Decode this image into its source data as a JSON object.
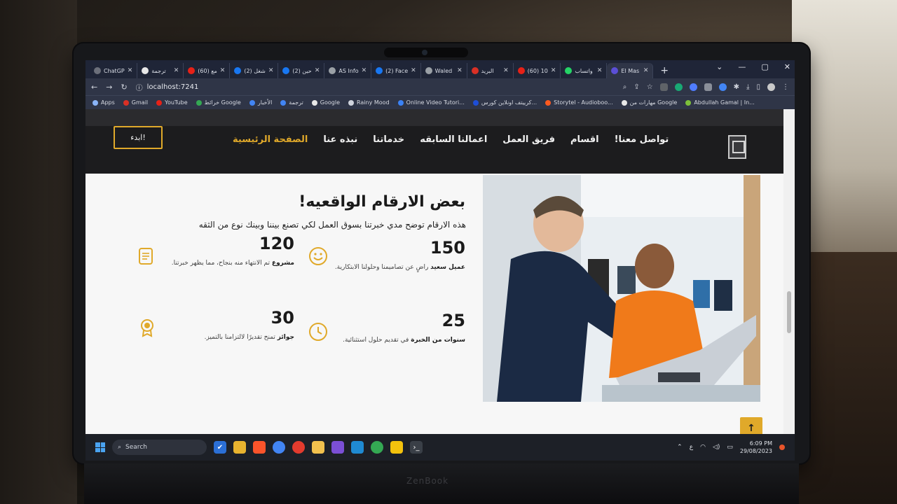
{
  "browser": {
    "tabs": [
      {
        "label": "ChatGP",
        "icon": "chatgpt-icon",
        "color": "#6b6f7a"
      },
      {
        "label": "ترجمة",
        "icon": "google-icon",
        "color": "#e8e8e8"
      },
      {
        "label": "(60) مع",
        "icon": "youtube-icon",
        "color": "#e62117"
      },
      {
        "label": "(2) شغل",
        "icon": "facebook-icon",
        "color": "#1877f2"
      },
      {
        "label": "(2) حين",
        "icon": "facebook-icon",
        "color": "#1877f2"
      },
      {
        "label": "AS Info",
        "icon": "globe-icon",
        "color": "#9aa0a6"
      },
      {
        "label": "(2) Face",
        "icon": "facebook-icon",
        "color": "#1877f2"
      },
      {
        "label": "Waled",
        "icon": "globe-icon",
        "color": "#9aa0a6"
      },
      {
        "label": "البريد",
        "icon": "gmail-icon",
        "color": "#d93025"
      },
      {
        "label": "(60) 10",
        "icon": "youtube-icon",
        "color": "#e62117"
      },
      {
        "label": "واتساب",
        "icon": "whatsapp-icon",
        "color": "#25d366"
      },
      {
        "label": "El Mas",
        "icon": "site-icon",
        "color": "#5b4fd6"
      }
    ],
    "url": "localhost:7241",
    "bookmarks": [
      {
        "label": "Apps",
        "color": "#8ab4f8"
      },
      {
        "label": "Gmail",
        "color": "#d93025"
      },
      {
        "label": "YouTube",
        "color": "#e62117"
      },
      {
        "label": "خرائط Google",
        "color": "#34a853"
      },
      {
        "label": "الأخبار",
        "color": "#4285f4"
      },
      {
        "label": "ترجمة",
        "color": "#4285f4"
      },
      {
        "label": "Google",
        "color": "#e8e8e8"
      },
      {
        "label": "Rainy Mood",
        "color": "#cfd3dc"
      },
      {
        "label": "Online Video Tutori...",
        "color": "#3b82f6"
      },
      {
        "label": "كرييتف اونلاين كورس...",
        "color": "#1d4ed8"
      },
      {
        "label": "Storytel - Audioboo...",
        "color": "#ff5a1f"
      },
      {
        "label": "مهارات من Google",
        "color": "#e8e8e8"
      },
      {
        "label": "Abdullah Gamal | In...",
        "color": "#7cbf3a"
      }
    ]
  },
  "site": {
    "start_button": "ابدء!",
    "nav": [
      {
        "label": "الصفحة الرئيسية",
        "active": true
      },
      {
        "label": "نبذه عنا",
        "active": false
      },
      {
        "label": "خدماتنا",
        "active": false
      },
      {
        "label": "اعمالنا السابقه",
        "active": false
      },
      {
        "label": "فريق العمل",
        "active": false
      },
      {
        "label": "اقسام",
        "active": false
      },
      {
        "label": "تواصل معنا!",
        "active": false
      }
    ],
    "heading": "بعض الارقام الواقعيه!",
    "subheading": "هذه الارقام توضح مدي خبرتنا بسوق العمل لكي تصنع بيننا وبينك نوع من الثقه",
    "stats": [
      {
        "number": "150",
        "bold": "عميل سعيد",
        "text": "راضٍ عن تصاميمنا وحلولنا الابتكارية.",
        "icon": "smiley-icon"
      },
      {
        "number": "120",
        "bold": "مشروع",
        "text": "تم الانتهاء منه بنجاح، مما يظهر خبرتنا.",
        "icon": "clipboard-icon"
      },
      {
        "number": "25",
        "bold": "سنوات من الخبرة",
        "text": "في تقديم حلول استثنائية.",
        "icon": "clock-icon"
      },
      {
        "number": "30",
        "bold": "جوائز",
        "text": "تمنح تقديرًا لالتزامنا بالتميز.",
        "icon": "award-icon"
      }
    ],
    "accent_color": "#e0a92a"
  },
  "taskbar": {
    "search_label": "Search",
    "tray_lang": "ع",
    "time": "6:09 PM",
    "date": "29/08/2023"
  },
  "device": {
    "brand": "ZenBook"
  }
}
